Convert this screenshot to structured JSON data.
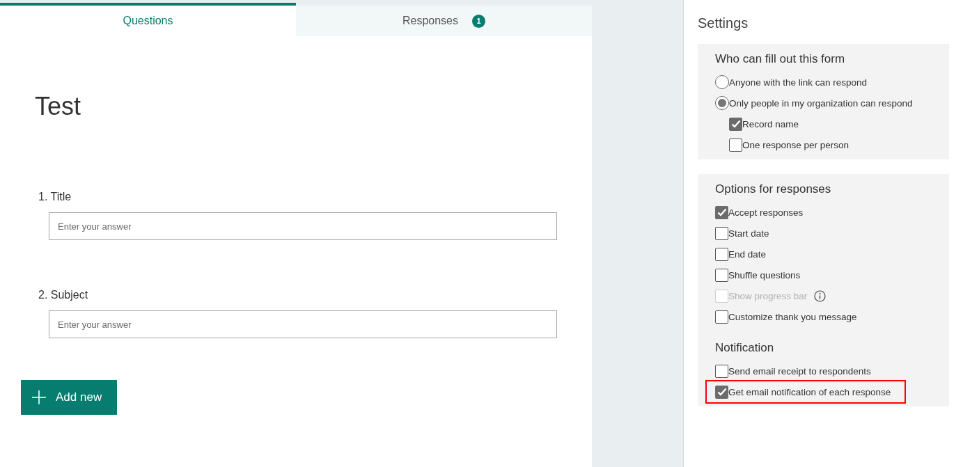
{
  "tabs": [
    {
      "label": "Questions",
      "selected": true
    },
    {
      "label": "Responses",
      "selected": false,
      "badge": "1"
    }
  ],
  "form": {
    "title": "Test",
    "questions": [
      {
        "number": "1.",
        "label": "Title",
        "placeholder": "Enter your answer"
      },
      {
        "number": "2.",
        "label": "Subject",
        "placeholder": "Enter your answer"
      }
    ],
    "add_button": "Add new"
  },
  "settings": {
    "title": "Settings",
    "sections": [
      {
        "groups": [
          {
            "heading": "Who can fill out this form",
            "items": [
              {
                "kind": "radio",
                "label": "Anyone with the link can respond",
                "selected": false,
                "disabled": false,
                "highlighted": false
              },
              {
                "kind": "radio",
                "label": "Only people in my organization can respond",
                "selected": true,
                "disabled": false,
                "highlighted": false,
                "children": [
                  {
                    "kind": "checkbox",
                    "label": "Record name",
                    "checked": true,
                    "disabled": false,
                    "highlighted": false
                  },
                  {
                    "kind": "checkbox",
                    "label": "One response per person",
                    "checked": false,
                    "disabled": false,
                    "highlighted": false
                  }
                ]
              }
            ]
          }
        ]
      },
      {
        "groups": [
          {
            "heading": "Options for responses",
            "items": [
              {
                "kind": "checkbox",
                "label": "Accept responses",
                "checked": true,
                "disabled": false,
                "highlighted": false
              },
              {
                "kind": "checkbox",
                "label": "Start date",
                "checked": false,
                "disabled": false,
                "highlighted": false
              },
              {
                "kind": "checkbox",
                "label": "End date",
                "checked": false,
                "disabled": false,
                "highlighted": false
              },
              {
                "kind": "checkbox",
                "label": "Shuffle questions",
                "checked": false,
                "disabled": false,
                "highlighted": false
              },
              {
                "kind": "checkbox",
                "label": "Show progress bar",
                "checked": false,
                "disabled": true,
                "highlighted": false,
                "info": true
              },
              {
                "kind": "checkbox",
                "label": "Customize thank you message",
                "checked": false,
                "disabled": false,
                "highlighted": false
              }
            ]
          },
          {
            "heading": "Notification",
            "items": [
              {
                "kind": "checkbox",
                "label": "Send email receipt to respondents",
                "checked": false,
                "disabled": false,
                "highlighted": false
              },
              {
                "kind": "checkbox",
                "label": "Get email notification of each response",
                "checked": true,
                "disabled": false,
                "highlighted": true
              }
            ]
          }
        ]
      }
    ]
  }
}
